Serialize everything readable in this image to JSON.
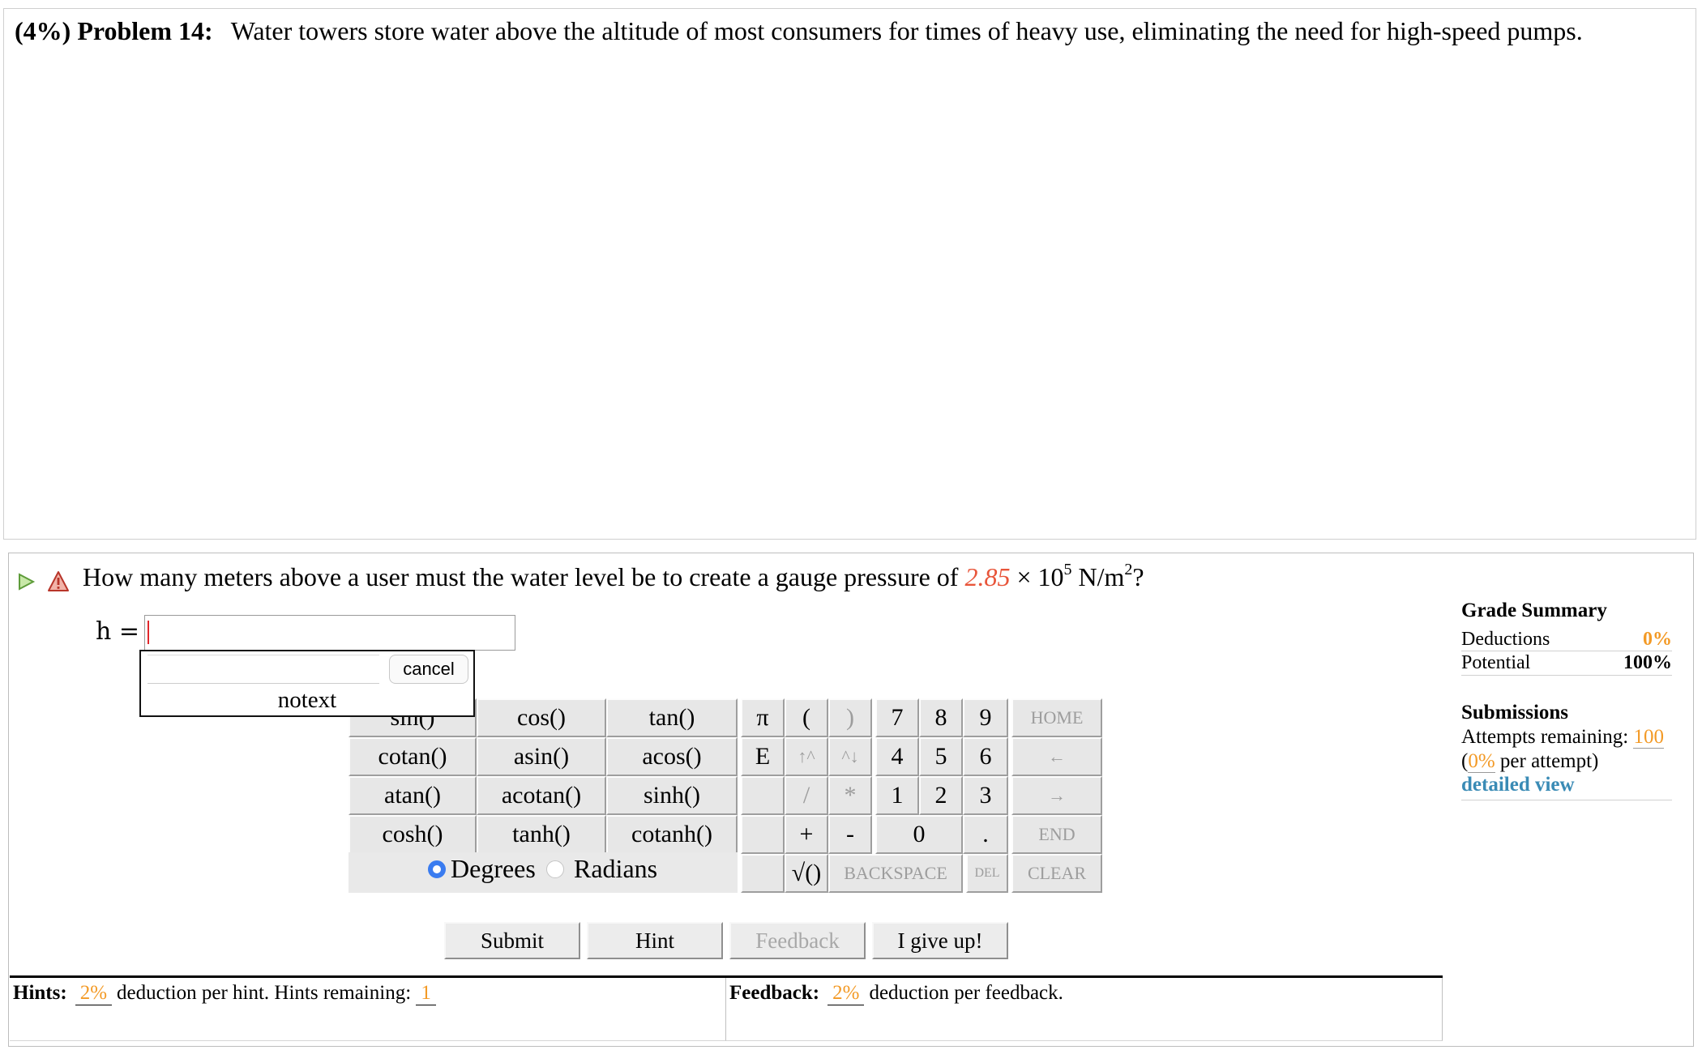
{
  "problem": {
    "weight": "(4%)",
    "label": "Problem 14:",
    "statement": "Water towers store water above the altitude of most consumers for times of heavy use, eliminating the need for high-speed pumps."
  },
  "question": {
    "text_before": "How many meters above a user must the water level be to create a gauge pressure of ",
    "given_value": "2.85",
    "text_times": " × 10",
    "exponent": "5",
    "unit_base": " N/m",
    "unit_exp": "2",
    "text_after": "?",
    "variable_label": "h =",
    "answer_value": ""
  },
  "popup": {
    "input_value": "",
    "cancel_label": "cancel",
    "notext_label": "notext"
  },
  "keypad": {
    "functions": [
      [
        "sin()",
        "cos()",
        "tan()"
      ],
      [
        "cotan()",
        "asin()",
        "acos()"
      ],
      [
        "atan()",
        "acotan()",
        "sinh()"
      ],
      [
        "cosh()",
        "tanh()",
        "cotanh()"
      ]
    ],
    "constants": [
      "π",
      "E"
    ],
    "paren_open": "(",
    "paren_close": ")",
    "pow_up": "↑^",
    "pow_down": "^↓",
    "divide": "/",
    "multiply": "*",
    "plus": "+",
    "minus": "-",
    "sqrt": "√()",
    "digits_row1": [
      "7",
      "8",
      "9"
    ],
    "digits_row2": [
      "4",
      "5",
      "6"
    ],
    "digits_row3": [
      "1",
      "2",
      "3"
    ],
    "zero": "0",
    "dot": ".",
    "home": "HOME",
    "left_arrow": "←",
    "right_arrow": "→",
    "end": "END",
    "backspace": "BACKSPACE",
    "del": "DEL",
    "clear": "CLEAR",
    "angle_degrees": "Degrees",
    "angle_radians": "Radians",
    "angle_selected": "Degrees"
  },
  "buttons": {
    "submit": "Submit",
    "hint": "Hint",
    "feedback": "Feedback",
    "give_up": "I give up!"
  },
  "grade_summary": {
    "title": "Grade Summary",
    "deductions_label": "Deductions",
    "deductions_value": "0%",
    "potential_label": "Potential",
    "potential_value": "100%"
  },
  "submissions": {
    "title": "Submissions",
    "attempts_label": "Attempts remaining: ",
    "attempts_value": "100",
    "per_attempt_open": "(",
    "per_attempt_value": "0%",
    "per_attempt_text": " per attempt)",
    "detailed_view": "detailed view"
  },
  "hints": {
    "label": "Hints:",
    "deduction": "2%",
    "text": "deduction per hint. Hints remaining:",
    "remaining": "1"
  },
  "feedback": {
    "label": "Feedback:",
    "deduction": "2%",
    "text": "deduction per feedback."
  },
  "colors": {
    "given_value": "#e8553a",
    "orange": "#f39a26",
    "link": "#3a8bb5",
    "radio_selected": "#3a7cf0"
  }
}
